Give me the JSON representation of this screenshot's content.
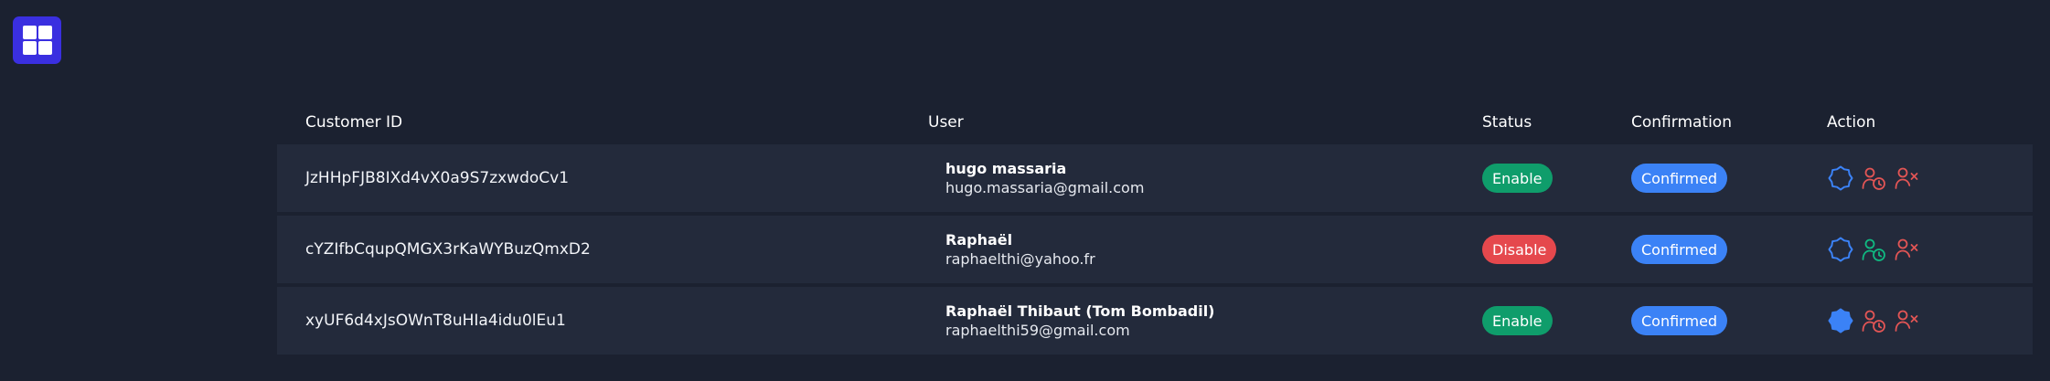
{
  "app": {
    "logo_icon": "grid-logo-icon",
    "brand_color": "#3a2fe0"
  },
  "table": {
    "headers": {
      "customer_id": "Customer ID",
      "user": "User",
      "status": "Status",
      "confirmation": "Confirmation",
      "action": "Action"
    },
    "rows": [
      {
        "customer_id": "JzHHpFJB8IXd4vX0a9S7zxwdoCv1",
        "user_name": "hugo massaria",
        "user_email": "hugo.massaria@gmail.com",
        "status": "Enable",
        "status_color": "#0f9d6b",
        "confirmation": "Confirmed",
        "badge_icon": "verified-badge-outline-icon",
        "history_icon": "user-clock-icon",
        "history_color": "#e25555",
        "remove_icon": "user-remove-icon"
      },
      {
        "customer_id": "cYZIfbCqupQMGX3rKaWYBuzQmxD2",
        "user_name": "Raphaël",
        "user_email": "raphaelthi@yahoo.fr",
        "status": "Disable",
        "status_color": "#e5484d",
        "confirmation": "Confirmed",
        "badge_icon": "verified-badge-outline-icon",
        "history_icon": "user-clock-icon",
        "history_color": "#10b981",
        "remove_icon": "user-remove-icon"
      },
      {
        "customer_id": "xyUF6d4xJsOWnT8uHIa4idu0lEu1",
        "user_name": "Raphaël Thibaut (Tom Bombadil)",
        "user_email": "raphaelthi59@gmail.com",
        "status": "Enable",
        "status_color": "#0f9d6b",
        "confirmation": "Confirmed",
        "badge_icon": "verified-badge-filled-icon",
        "history_icon": "user-clock-icon",
        "history_color": "#e25555",
        "remove_icon": "user-remove-icon"
      }
    ]
  },
  "colors": {
    "background": "#1b2130",
    "row_background": "#232a3b",
    "confirmed_badge": "#3b82f6",
    "badge_icon": "#3b82f6",
    "remove_icon": "#e25555"
  }
}
